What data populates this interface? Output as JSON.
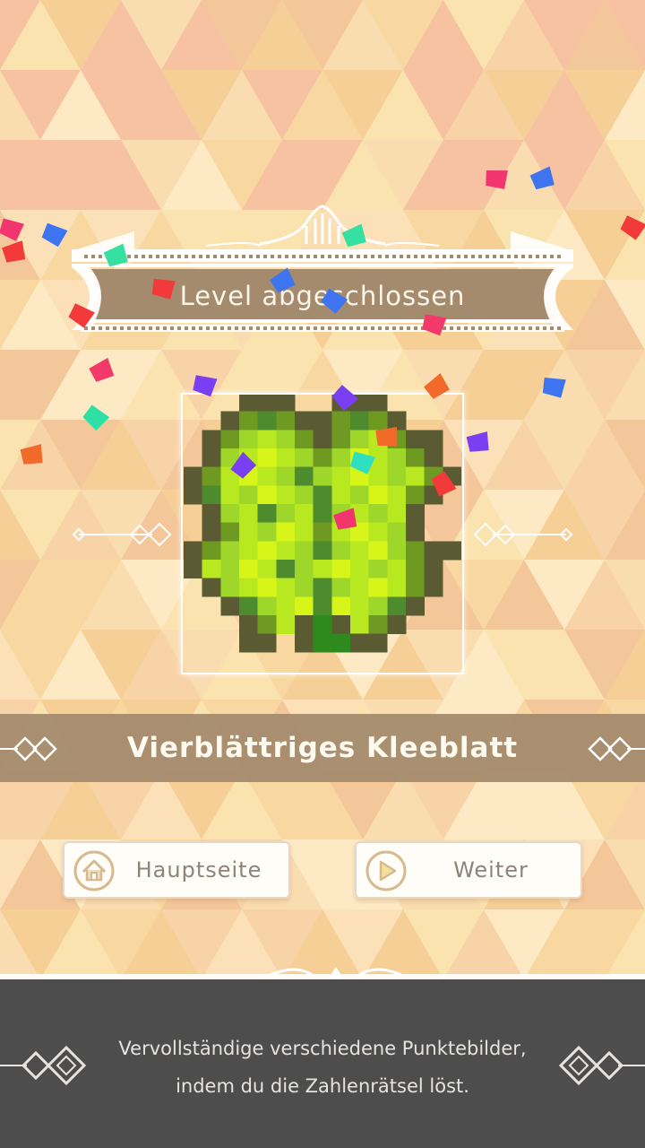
{
  "header": {
    "title": "Level abgeschlossen"
  },
  "artwork": {
    "name": "Vierblättriges Kleeblatt"
  },
  "buttons": {
    "home_label": "Hauptseite",
    "next_label": "Weiter"
  },
  "footer": {
    "line1": "Vervollständige verschiedene Punktebilder,",
    "line2": "indem du die Zahlenrätsel löst."
  },
  "icons": {
    "home": "home-icon",
    "next": "play-icon",
    "ornament": "diamond-ornament-icon"
  },
  "colors": {
    "banner": "#a48b6d",
    "footer": "#4d4d4d",
    "button_text": "#8d8378",
    "clover_dark": "#5a5b33",
    "clover_bright": "#c9f21c"
  }
}
